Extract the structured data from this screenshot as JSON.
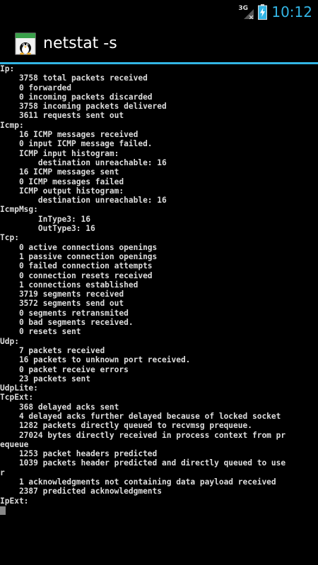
{
  "status_bar": {
    "network_label": "3G",
    "time": "10:12"
  },
  "action_bar": {
    "title": "netstat -s"
  },
  "terminal": {
    "lines": [
      "Ip:",
      "    3758 total packets received",
      "    0 forwarded",
      "    0 incoming packets discarded",
      "    3758 incoming packets delivered",
      "    3611 requests sent out",
      "Icmp:",
      "    16 ICMP messages received",
      "    0 input ICMP message failed.",
      "    ICMP input histogram:",
      "        destination unreachable: 16",
      "    16 ICMP messages sent",
      "    0 ICMP messages failed",
      "    ICMP output histogram:",
      "        destination unreachable: 16",
      "IcmpMsg:",
      "        InType3: 16",
      "        OutType3: 16",
      "Tcp:",
      "    0 active connections openings",
      "    1 passive connection openings",
      "    0 failed connection attempts",
      "    0 connection resets received",
      "    1 connections established",
      "    3719 segments received",
      "    3572 segments send out",
      "    0 segments retransmited",
      "    0 bad segments received.",
      "    0 resets sent",
      "Udp:",
      "    7 packets received",
      "    16 packets to unknown port received.",
      "    0 packet receive errors",
      "    23 packets sent",
      "UdpLite:",
      "TcpExt:",
      "    368 delayed acks sent",
      "    4 delayed acks further delayed because of locked socket",
      "    1282 packets directly queued to recvmsg prequeue.",
      "    27024 bytes directly received in process context from pr",
      "equeue",
      "    1253 packet headers predicted",
      "    1039 packets header predicted and directly queued to use",
      "r",
      "    1 acknowledgments not containing data payload received",
      "    2387 predicted acknowledgments",
      "IpExt:"
    ]
  },
  "icons": {
    "signal": "signal-icon",
    "battery": "battery-charging-icon",
    "app": "tux-app-icon"
  },
  "colors": {
    "accent": "#33b5e5",
    "terminal_text": "#dddddd",
    "background": "#000000"
  }
}
